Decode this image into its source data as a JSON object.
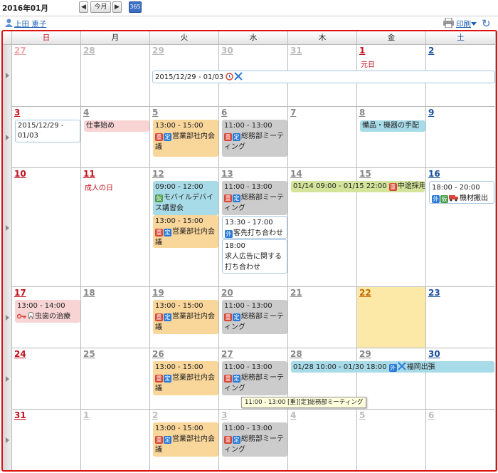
{
  "header": {
    "title": "2016年01月",
    "today_label": "今月",
    "year_label": "365"
  },
  "user": {
    "name": "上田 恵子"
  },
  "toolbar": {
    "print_label": "印刷"
  },
  "weekdays": [
    "日",
    "月",
    "火",
    "水",
    "木",
    "金",
    "土"
  ],
  "weeks": [
    {
      "days": [
        "27",
        "28",
        "29",
        "30",
        "31",
        "1",
        "2"
      ],
      "holidays": {
        "5": "元日"
      }
    },
    {
      "days": [
        "3",
        "4",
        "5",
        "6",
        "7",
        "8",
        "9"
      ]
    },
    {
      "days": [
        "10",
        "11",
        "12",
        "13",
        "14",
        "15",
        "16"
      ],
      "holidays": {
        "1": "成人の日"
      }
    },
    {
      "days": [
        "17",
        "18",
        "19",
        "20",
        "21",
        "22",
        "23"
      ]
    },
    {
      "days": [
        "24",
        "25",
        "26",
        "27",
        "28",
        "29",
        "30"
      ]
    },
    {
      "days": [
        "31",
        "1",
        "2",
        "3",
        "4",
        "5",
        "6"
      ]
    }
  ],
  "events": {
    "w1_span": "2015/12/29 - 01/03",
    "w2_sun": "2015/12/29 - 01/03",
    "w2_mon": "仕事始め",
    "w2_tue_time": "13:00 - 15:00",
    "w2_tue_title": "営業部社内会議",
    "w2_wed_time": "11:00 - 13:00",
    "w2_wed_title": "総務部ミーティング",
    "w2_fri": "備品・機器の手配",
    "w3_tue1_time": "09:00 - 12:00",
    "w3_tue1_title": "モバイルデバイス講習会",
    "w3_tue2_time": "13:00 - 15:00",
    "w3_tue2_title": "営業部社内会議",
    "w3_wed1_time": "11:00 - 13:00",
    "w3_wed1_title": "総務部ミーティング",
    "w3_wed2_time": "13:30 - 17:00",
    "w3_wed2_title": "客先打ち合わせ",
    "w3_wed3_time": "18:00",
    "w3_wed3_title": "求人広告に関する打ち合わせ",
    "w3_span": "01/14 09:00 - 01/15 22:00",
    "w3_span_title": "中途採用...",
    "w3_sat_time": "18:00 - 20:00",
    "w3_sat_title": "機材搬出",
    "w4_sun_time": "13:00 - 14:00",
    "w4_sun_title": "虫歯の治療",
    "w4_tue_time": "13:00 - 15:00",
    "w4_tue_title": "営業部社内会議",
    "w4_wed_time": "11:00 - 13:00",
    "w4_wed_title": "総務部ミーティング",
    "w5_tue_time": "13:00 - 15:00",
    "w5_tue_title": "営業部社内会議",
    "w5_wed_time": "11:00 - 13:00",
    "w5_wed_title": "総務部ミーティング",
    "w5_span": "01/28 10:00 - 01/30 18:00",
    "w5_span_title": "福岡出張",
    "w6_tue_time": "13:00 - 15:00",
    "w6_tue_title": "営業部社内会議",
    "w6_wed_time": "11:00 - 13:00",
    "w6_wed_title": "総務部ミーティング"
  },
  "badges": {
    "important": "重",
    "fixed": "定",
    "out": "外",
    "share": "仮"
  },
  "tooltip": "11:00 - 13:00 [重][定]総務部ミーティング",
  "colors": {
    "border": "#d11",
    "orange": "#f9d69a",
    "gray": "#cccccc",
    "cyan": "#a8dbe8",
    "pink": "#f8d4d4",
    "lime": "#d4e59b"
  }
}
